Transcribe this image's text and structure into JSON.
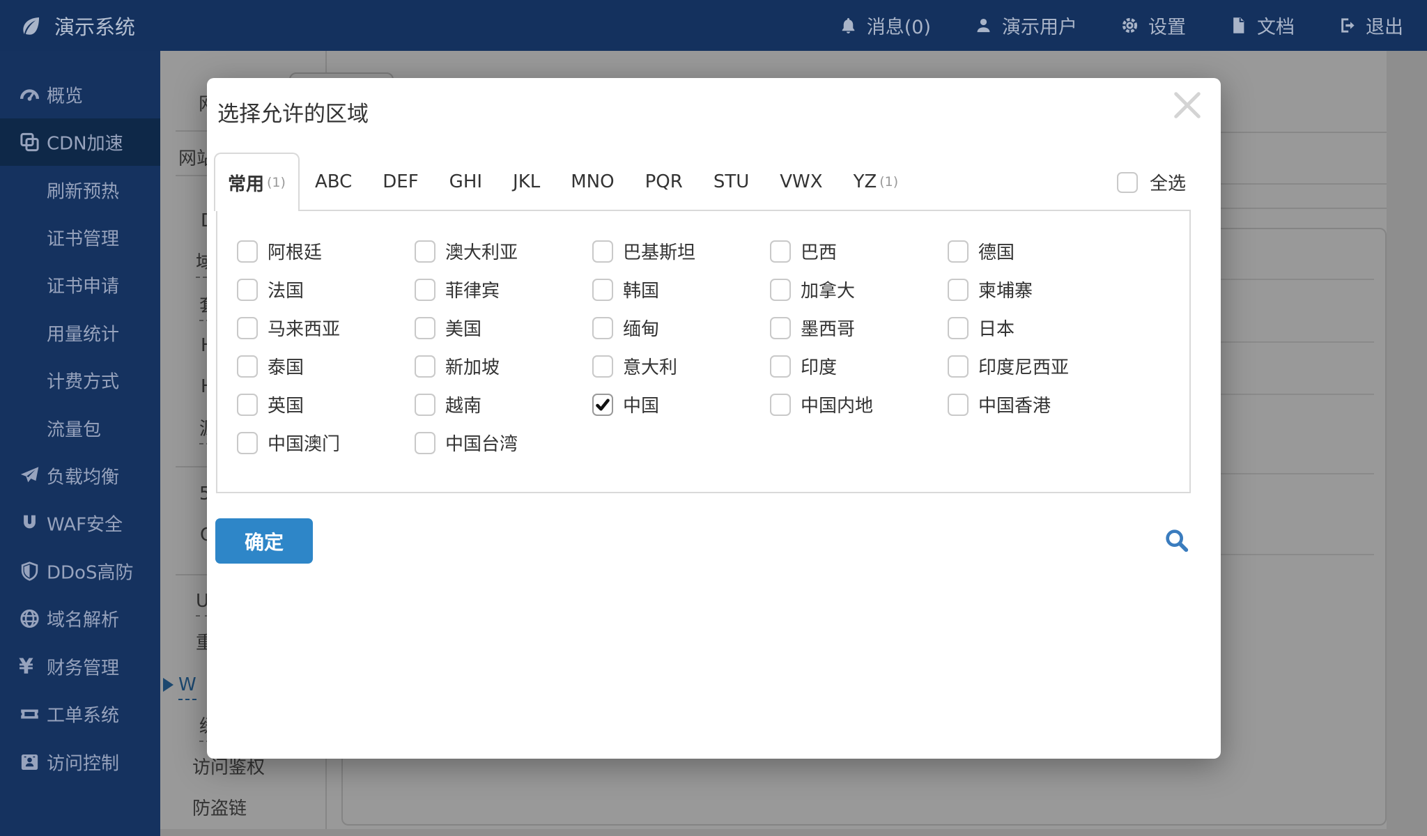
{
  "colors": {
    "navbar": "#14315e",
    "sidebar": "#15325f",
    "sidebar_active": "#0e2848",
    "accent_blue": "#2e86c8",
    "link_blue": "#2f79b9"
  },
  "topnav": {
    "brand": "演示系统",
    "items": [
      {
        "key": "messages",
        "icon": "bell",
        "label": "消息(0)"
      },
      {
        "key": "user",
        "icon": "user",
        "label": "演示用户"
      },
      {
        "key": "settings",
        "icon": "gear",
        "label": "设置"
      },
      {
        "key": "docs",
        "icon": "file",
        "label": "文档"
      },
      {
        "key": "logout",
        "icon": "signout",
        "label": "退出"
      }
    ]
  },
  "sidebar": {
    "items": [
      {
        "key": "overview",
        "icon": "dashboard",
        "label": "概览",
        "type": "main"
      },
      {
        "key": "cdn",
        "icon": "cdn",
        "label": "CDN加速",
        "type": "main",
        "active": true
      },
      {
        "key": "refresh-prewarm",
        "label": "刷新预热",
        "type": "sub"
      },
      {
        "key": "cert-manage",
        "label": "证书管理",
        "type": "sub"
      },
      {
        "key": "cert-apply",
        "label": "证书申请",
        "type": "sub"
      },
      {
        "key": "usage-stats",
        "label": "用量统计",
        "type": "sub"
      },
      {
        "key": "billing-method",
        "label": "计费方式",
        "type": "sub"
      },
      {
        "key": "traffic-package",
        "label": "流量包",
        "type": "sub"
      },
      {
        "key": "load-balance",
        "icon": "plane",
        "label": "负载均衡",
        "type": "main"
      },
      {
        "key": "waf",
        "icon": "magnet",
        "label": "WAF安全",
        "type": "main"
      },
      {
        "key": "ddos",
        "icon": "shield",
        "label": "DDoS高防",
        "type": "main"
      },
      {
        "key": "dns",
        "icon": "globe",
        "label": "域名解析",
        "type": "main"
      },
      {
        "key": "finance",
        "icon": "yen",
        "label": "财务管理",
        "type": "main"
      },
      {
        "key": "tickets",
        "icon": "ticket",
        "label": "工单系统",
        "type": "main"
      },
      {
        "key": "access-control",
        "icon": "idcard",
        "label": "访问控制",
        "type": "main"
      }
    ]
  },
  "background": {
    "submenu_fragments": [
      {
        "text": "网"
      },
      {
        "text": "网站"
      },
      {
        "text": "D"
      },
      {
        "text": "域",
        "dashed": true
      },
      {
        "text": "套",
        "dashed": true
      },
      {
        "text": "H"
      },
      {
        "text": "H"
      },
      {
        "text": "源",
        "dashed": true
      },
      {
        "text": "5"
      },
      {
        "text": "C"
      },
      {
        "text": "U",
        "dashed": true
      },
      {
        "text": "重"
      },
      {
        "text": "W",
        "dashed": true,
        "active": true
      },
      {
        "text": "缓",
        "dashed": true
      },
      {
        "text": "访问鉴权"
      },
      {
        "text": "防盗链"
      }
    ]
  },
  "modal": {
    "title": "选择允许的区域",
    "tabs": [
      {
        "label": "常用",
        "count": "(1)",
        "active": true
      },
      {
        "label": "ABC"
      },
      {
        "label": "DEF"
      },
      {
        "label": "GHI"
      },
      {
        "label": "JKL"
      },
      {
        "label": "MNO"
      },
      {
        "label": "PQR"
      },
      {
        "label": "STU"
      },
      {
        "label": "VWX"
      },
      {
        "label": "YZ",
        "count": "(1)"
      }
    ],
    "select_all_label": "全选",
    "regions": [
      {
        "label": "阿根廷"
      },
      {
        "label": "澳大利亚"
      },
      {
        "label": "巴基斯坦"
      },
      {
        "label": "巴西"
      },
      {
        "label": "德国"
      },
      {
        "label": "法国"
      },
      {
        "label": "菲律宾"
      },
      {
        "label": "韩国"
      },
      {
        "label": "加拿大"
      },
      {
        "label": "柬埔寨"
      },
      {
        "label": "马来西亚"
      },
      {
        "label": "美国"
      },
      {
        "label": "缅甸"
      },
      {
        "label": "墨西哥"
      },
      {
        "label": "日本"
      },
      {
        "label": "泰国"
      },
      {
        "label": "新加坡"
      },
      {
        "label": "意大利"
      },
      {
        "label": "印度"
      },
      {
        "label": "印度尼西亚"
      },
      {
        "label": "英国"
      },
      {
        "label": "越南"
      },
      {
        "label": "中国",
        "checked": true
      },
      {
        "label": "中国内地"
      },
      {
        "label": "中国香港"
      },
      {
        "label": "中国澳门"
      },
      {
        "label": "中国台湾"
      }
    ],
    "confirm_label": "确定"
  }
}
